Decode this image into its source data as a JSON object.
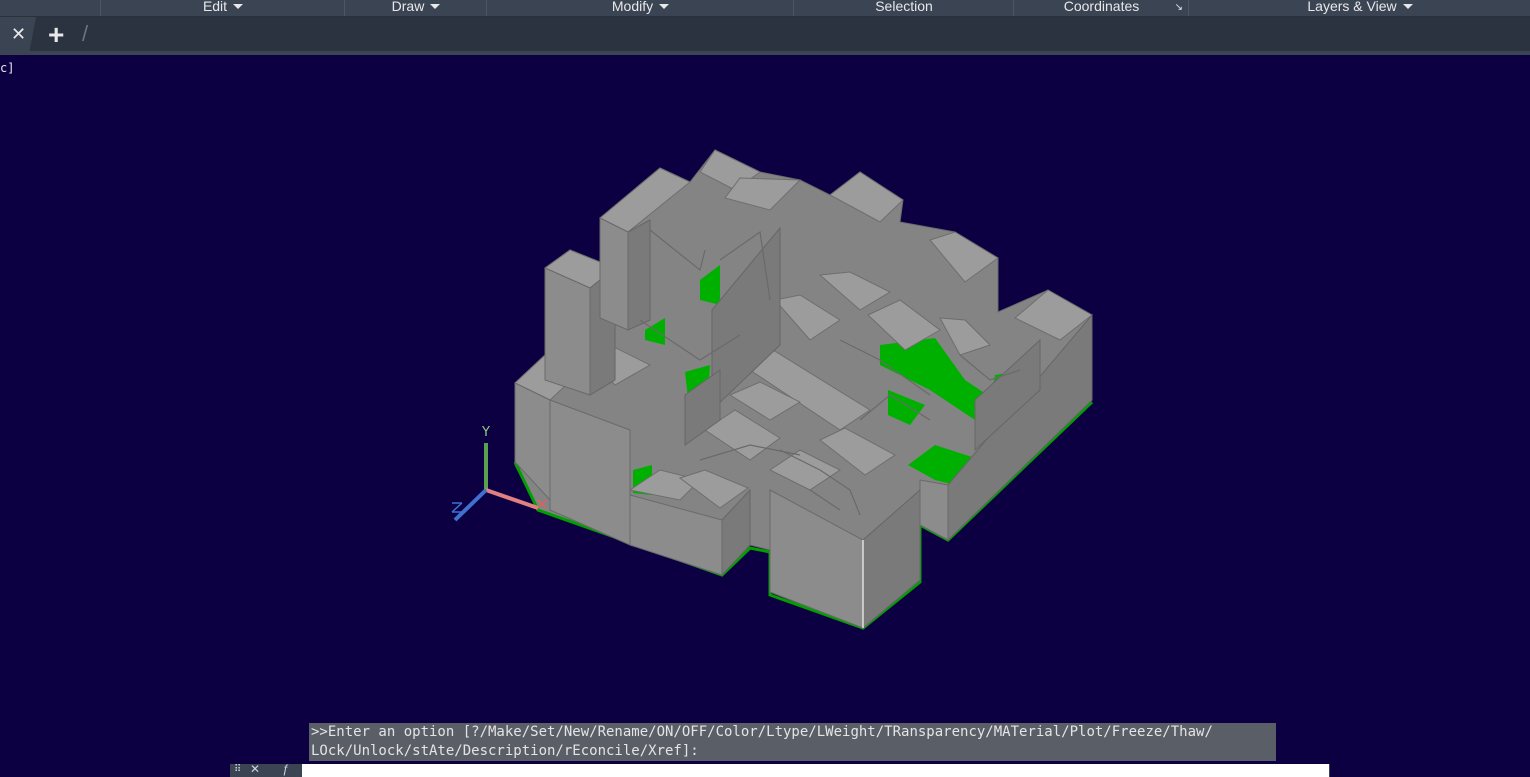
{
  "ribbon": {
    "groups": [
      {
        "label": "Edit",
        "dropdown": true
      },
      {
        "label": "Draw",
        "dropdown": true
      },
      {
        "label": "Modify",
        "dropdown": true
      },
      {
        "label": "Selection",
        "dropdown": false
      },
      {
        "label": "Coordinates",
        "dropdown": false
      },
      {
        "label": "Layers & View",
        "dropdown": true
      }
    ]
  },
  "tabs": {
    "close_glyph": "✕",
    "new_tab_glyph": "+",
    "separator_glyph": "/"
  },
  "viewport": {
    "corner_label": "c]",
    "background": "#0d0042",
    "wall_color": "#8a8a8a",
    "floor_color": "#00b000",
    "ucs_icon": {
      "y_label": "Y",
      "x_color": "#e07070",
      "y_color": "#5aa050",
      "z_color": "#4070d0"
    }
  },
  "command": {
    "history_line1": ">>Enter an option [?/Make/Set/New/Rename/ON/OFF/Color/Ltype/LWeight/TRansparency/MATerial/Plot/Freeze/Thaw/",
    "history_line2": "LOck/Unlock/stAte/Description/rEconcile/Xref]:",
    "input_value": "",
    "grip_glyph": "⠿",
    "close_glyph": "✕",
    "fx_glyph": "ƒ"
  }
}
